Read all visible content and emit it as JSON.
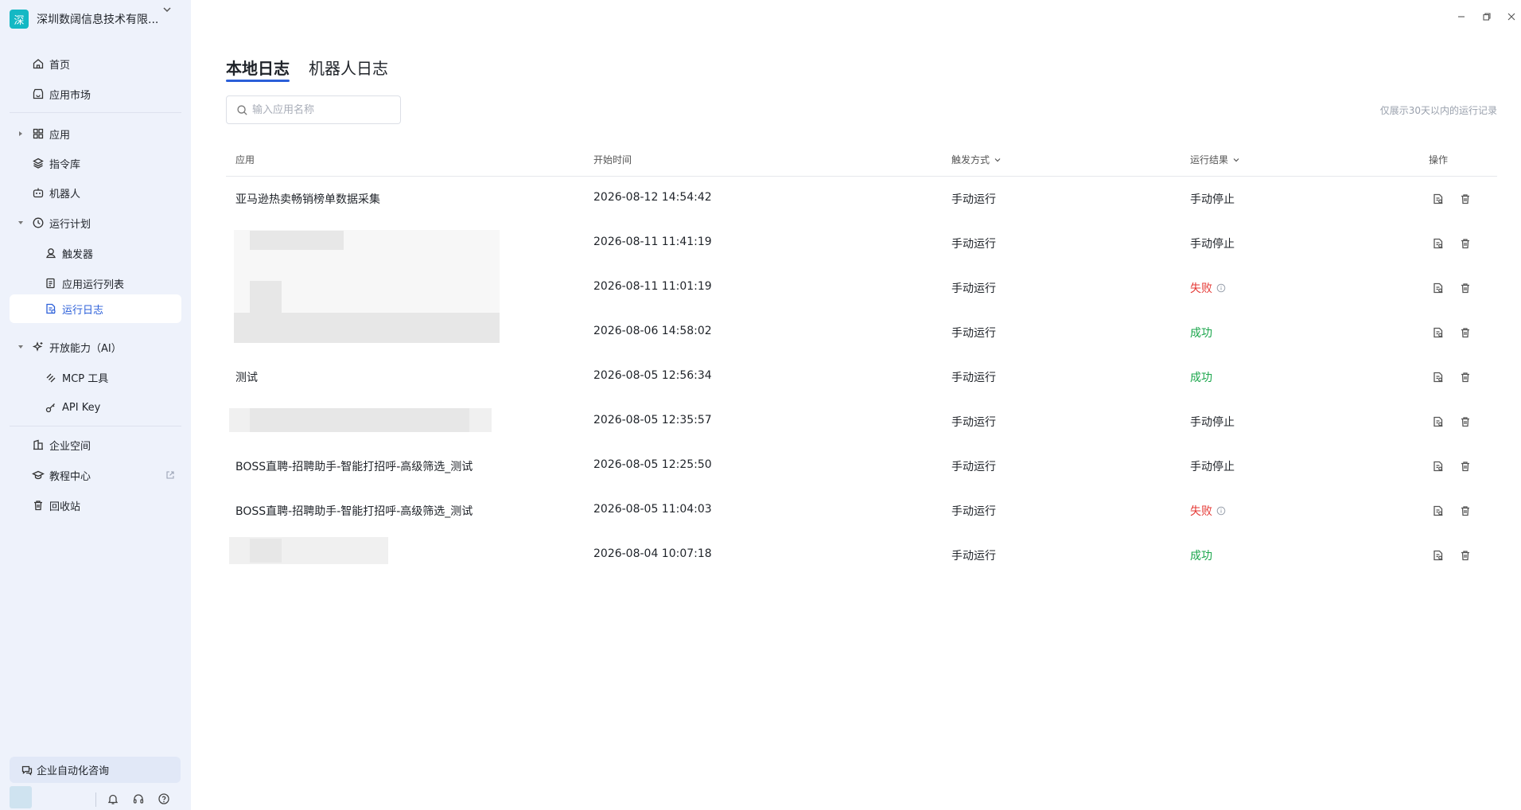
{
  "sidebar": {
    "org_logo": "深",
    "org_name": "深圳数阔信息技术有限...",
    "items": [
      {
        "label": "首页",
        "icon": "home-icon"
      },
      {
        "label": "应用市场",
        "icon": "market-icon"
      },
      {
        "label": "应用",
        "icon": "apps-grid-icon"
      },
      {
        "label": "指令库",
        "icon": "layers-icon"
      },
      {
        "label": "机器人",
        "icon": "robot-icon"
      },
      {
        "label": "运行计划",
        "icon": "clock-icon"
      },
      {
        "label": "触发器",
        "icon": "trigger-icon"
      },
      {
        "label": "应用运行列表",
        "icon": "list-doc-icon"
      },
      {
        "label": "运行日志",
        "icon": "log-doc-icon"
      },
      {
        "label": "开放能力（AI）",
        "icon": "sparkle-icon"
      },
      {
        "label": "MCP 工具",
        "icon": "mcp-icon"
      },
      {
        "label": "API Key",
        "icon": "key-icon"
      },
      {
        "label": "企业空间",
        "icon": "building-icon"
      },
      {
        "label": "教程中心",
        "icon": "graduation-icon"
      },
      {
        "label": "回收站",
        "icon": "trash-icon"
      }
    ],
    "consult_label": "企业自动化咨询"
  },
  "tabs": [
    {
      "label": "本地日志",
      "active": true
    },
    {
      "label": "机器人日志",
      "active": false
    }
  ],
  "search": {
    "placeholder": "输入应用名称",
    "value": ""
  },
  "hint": "仅展示30天以内的运行记录",
  "table": {
    "columns": [
      "应用",
      "开始时间",
      "触发方式",
      "运行结果",
      "操作"
    ],
    "rows": [
      {
        "app": "亚马逊热卖畅销榜单数据采集",
        "start": "2026-08-12 14:54:42",
        "trigger": "手动运行",
        "result": "手动停止",
        "status": "stopped"
      },
      {
        "app": "",
        "start": "2026-08-11 11:41:19",
        "trigger": "手动运行",
        "result": "手动停止",
        "status": "stopped"
      },
      {
        "app": "",
        "start": "2026-08-11 11:01:19",
        "trigger": "手动运行",
        "result": "失败",
        "status": "fail"
      },
      {
        "app": "",
        "start": "2026-08-06 14:58:02",
        "trigger": "手动运行",
        "result": "成功",
        "status": "ok"
      },
      {
        "app": "测试",
        "start": "2026-08-05 12:56:34",
        "trigger": "手动运行",
        "result": "成功",
        "status": "ok"
      },
      {
        "app": "",
        "start": "2026-08-05 12:35:57",
        "trigger": "手动运行",
        "result": "手动停止",
        "status": "stopped"
      },
      {
        "app": "BOSS直聘-招聘助手-智能打招呼-高级筛选_测试",
        "start": "2026-08-05 12:25:50",
        "trigger": "手动运行",
        "result": "手动停止",
        "status": "stopped"
      },
      {
        "app": "BOSS直聘-招聘助手-智能打招呼-高级筛选_测试",
        "start": "2026-08-05 11:04:03",
        "trigger": "手动运行",
        "result": "失败",
        "status": "fail"
      },
      {
        "app": "",
        "start": "2026-08-04 10:07:18",
        "trigger": "手动运行",
        "result": "成功",
        "status": "ok"
      }
    ]
  },
  "colors": {
    "accent": "#2b5fd9",
    "success": "#1aa64b",
    "fail": "#e53935",
    "sidebar_bg": "#eef2fb"
  }
}
